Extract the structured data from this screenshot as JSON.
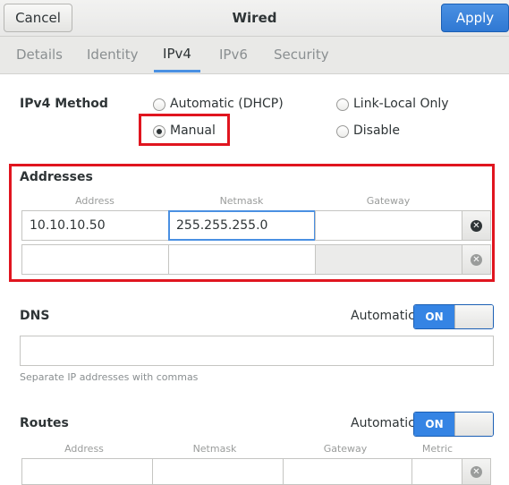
{
  "header": {
    "title": "Wired",
    "cancel_label": "Cancel",
    "apply_label": "Apply"
  },
  "tabs": [
    {
      "label": "Details"
    },
    {
      "label": "Identity"
    },
    {
      "label": "IPv4",
      "active": true
    },
    {
      "label": "IPv6"
    },
    {
      "label": "Security"
    }
  ],
  "ipv4_method": {
    "label": "IPv4 Method",
    "options": [
      {
        "label": "Automatic (DHCP)",
        "checked": false
      },
      {
        "label": "Link-Local Only",
        "checked": false
      },
      {
        "label": "Manual",
        "checked": true
      },
      {
        "label": "Disable",
        "checked": false
      }
    ]
  },
  "addresses": {
    "label": "Addresses",
    "columns": [
      "Address",
      "Netmask",
      "Gateway"
    ],
    "rows": [
      {
        "address": "10.10.10.50",
        "netmask": "255.255.255.0",
        "gateway": ""
      },
      {
        "address": "",
        "netmask": "",
        "gateway": ""
      }
    ]
  },
  "dns": {
    "label": "DNS",
    "automatic_label": "Automatic",
    "switch_label": "ON",
    "value": "",
    "hint": "Separate IP addresses with commas"
  },
  "routes": {
    "label": "Routes",
    "automatic_label": "Automatic",
    "switch_label": "ON",
    "columns": [
      "Address",
      "Netmask",
      "Gateway",
      "Metric"
    ]
  },
  "colors": {
    "accent": "#4a90e2",
    "highlight_box": "#e0151f",
    "switch_on": "#3584e4"
  }
}
